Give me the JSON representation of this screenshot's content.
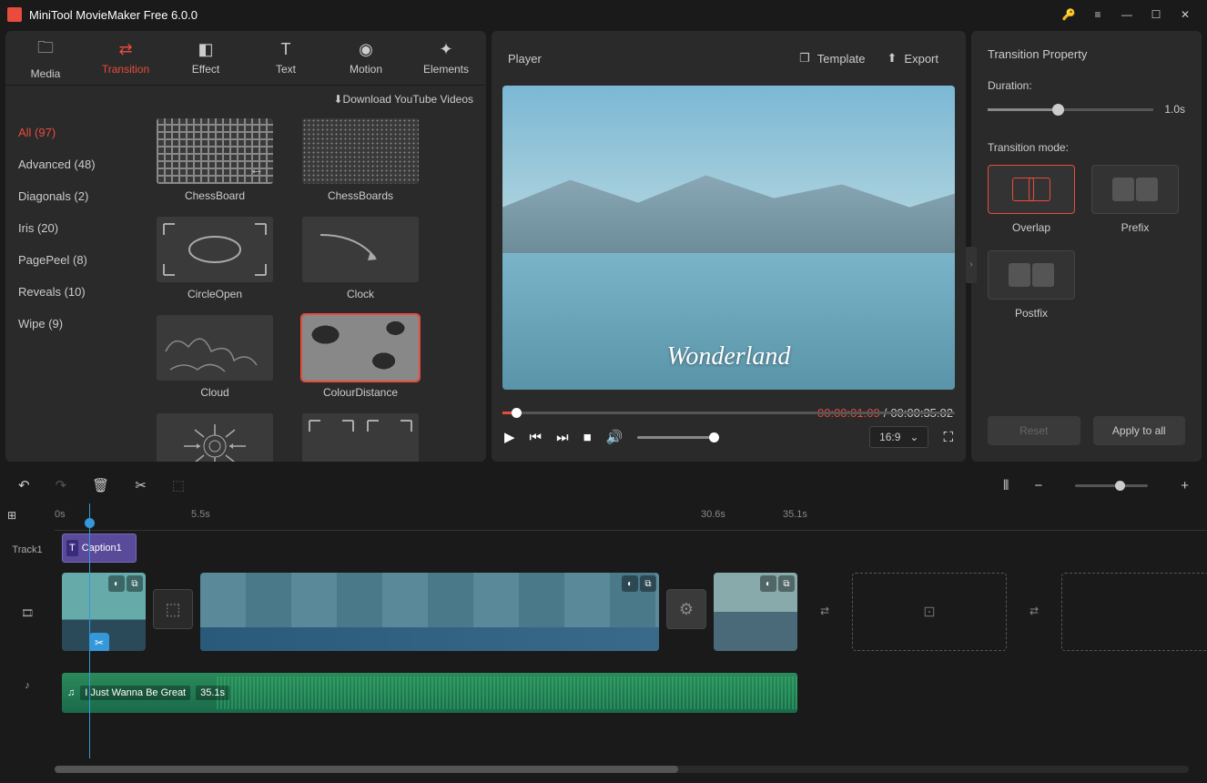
{
  "app": {
    "title": "MiniTool MovieMaker Free 6.0.0"
  },
  "toptabs": [
    {
      "label": "Media"
    },
    {
      "label": "Transition"
    },
    {
      "label": "Effect"
    },
    {
      "label": "Text"
    },
    {
      "label": "Motion"
    },
    {
      "label": "Elements"
    }
  ],
  "download_label": "Download YouTube Videos",
  "categories": [
    {
      "label": "All (97)"
    },
    {
      "label": "Advanced (48)"
    },
    {
      "label": "Diagonals (2)"
    },
    {
      "label": "Iris (20)"
    },
    {
      "label": "PagePeel (8)"
    },
    {
      "label": "Reveals (10)"
    },
    {
      "label": "Wipe (9)"
    }
  ],
  "transitions": [
    {
      "name": "ChessBoard"
    },
    {
      "name": "ChessBoards"
    },
    {
      "name": "CircleOpen"
    },
    {
      "name": "Clock"
    },
    {
      "name": "Cloud"
    },
    {
      "name": "ColourDistance"
    }
  ],
  "player": {
    "title": "Player",
    "template_label": "Template",
    "export_label": "Export",
    "overlay_text": "Wonderland",
    "current_time": "00:00:01.09",
    "divider": "/",
    "total_time": "00:00:35.02",
    "aspect": "16:9"
  },
  "property": {
    "title": "Transition Property",
    "duration_label": "Duration:",
    "duration_value": "1.0s",
    "mode_label": "Transition mode:",
    "modes": [
      {
        "name": "Overlap"
      },
      {
        "name": "Prefix"
      },
      {
        "name": "Postfix"
      }
    ],
    "reset_label": "Reset",
    "apply_label": "Apply to all"
  },
  "timeline": {
    "ticks": [
      {
        "label": "0s",
        "pos": 0
      },
      {
        "label": "5.5s",
        "pos": 155
      },
      {
        "label": "30.6s",
        "pos": 720
      },
      {
        "label": "35.1s",
        "pos": 815
      }
    ],
    "track1_label": "Track1",
    "caption_label": "Caption1",
    "audio_label": "I Just Wanna Be Great",
    "audio_duration": "35.1s"
  }
}
